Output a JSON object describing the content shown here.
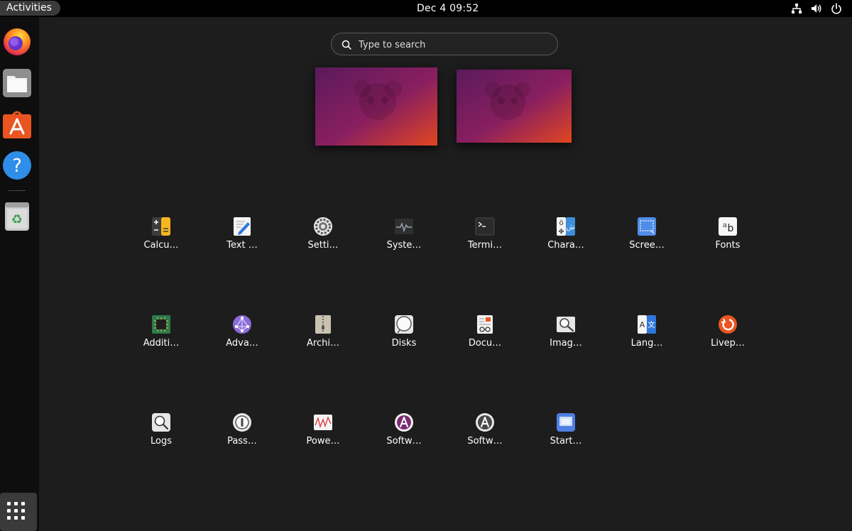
{
  "topbar": {
    "activities_label": "Activities",
    "clock": "Dec 4  09:52",
    "tray": [
      {
        "name": "network-icon"
      },
      {
        "name": "volume-icon"
      },
      {
        "name": "power-icon"
      }
    ]
  },
  "dock": {
    "apps": [
      {
        "name": "firefox-icon"
      },
      {
        "name": "files-icon"
      },
      {
        "name": "app-center-icon"
      },
      {
        "name": "help-icon"
      },
      {
        "name": "trash-icon"
      }
    ],
    "show_apps_icon": "grid-icon"
  },
  "search": {
    "placeholder": "Type to search",
    "value": ""
  },
  "workspaces": [
    {
      "name": "workspace-1"
    },
    {
      "name": "workspace-2"
    }
  ],
  "apps": [
    {
      "label": "Calcu…",
      "icon": "calculator-icon"
    },
    {
      "label": "Text …",
      "icon": "text-editor-icon"
    },
    {
      "label": "Setti…",
      "icon": "settings-gear-icon"
    },
    {
      "label": "Syste…",
      "icon": "system-monitor-icon"
    },
    {
      "label": "Termi…",
      "icon": "terminal-icon"
    },
    {
      "label": "Chara…",
      "icon": "characters-icon"
    },
    {
      "label": "Scree…",
      "icon": "screenshot-icon"
    },
    {
      "label": "Fonts",
      "icon": "fonts-icon"
    },
    {
      "label": "Additi…",
      "icon": "additional-drivers-icon"
    },
    {
      "label": "Adva…",
      "icon": "advanced-network-icon"
    },
    {
      "label": "Archi…",
      "icon": "archive-manager-icon"
    },
    {
      "label": "Disks",
      "icon": "disks-icon"
    },
    {
      "label": "Docu…",
      "icon": "document-viewer-icon"
    },
    {
      "label": "Imag…",
      "icon": "image-viewer-icon"
    },
    {
      "label": "Lang…",
      "icon": "language-support-icon"
    },
    {
      "label": "Livep…",
      "icon": "livepatch-icon"
    },
    {
      "label": "Logs",
      "icon": "logs-icon"
    },
    {
      "label": "Pass…",
      "icon": "passwords-keys-icon"
    },
    {
      "label": "Powe…",
      "icon": "power-statistics-icon"
    },
    {
      "label": "Softw…",
      "icon": "software-updater-icon"
    },
    {
      "label": "Softw…",
      "icon": "software-properties-icon"
    },
    {
      "label": "Start…",
      "icon": "startup-disk-icon"
    }
  ],
  "colors": {
    "background": "#1d1d1d",
    "topbar": "#000000",
    "dock": "#0e0e0e",
    "ubuntu_orange": "#e95420",
    "wallpaper_purple": "#6d1b63"
  }
}
